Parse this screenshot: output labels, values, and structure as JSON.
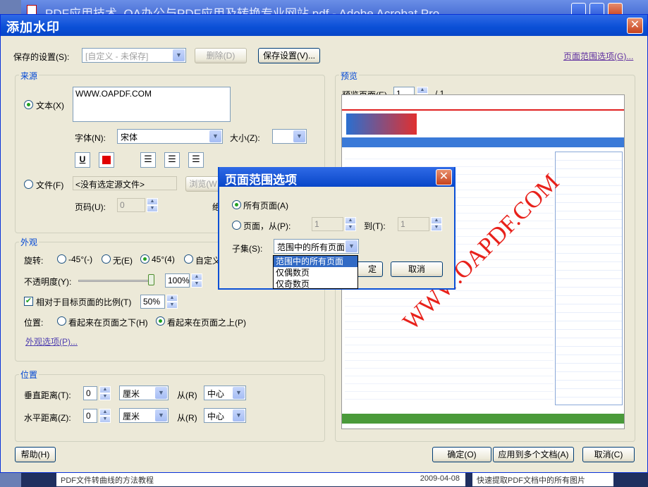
{
  "background_window": {
    "title": "PDF应用技术_OA办公与PDF应用及转换专业网站.pdf - Adobe Acrobat Pro",
    "bottom_left": "PDF文件转曲线的方法教程",
    "bottom_date": "2009-04-08",
    "bottom_right": "快速提取PDF文档中的所有图片"
  },
  "dialog": {
    "title": "添加水印",
    "close": "✕",
    "saved_settings_label": "保存的设置(S):",
    "saved_settings_value": "[自定义 - 未保存]",
    "delete_label": "删除(D)",
    "save_settings_label": "保存设置(V)...",
    "page_range_link": "页面范围选项(G)...",
    "source": {
      "title": "来源",
      "text_label": "文本(X)",
      "text_value": "WWW.OAPDF.COM",
      "font_label": "字体(N):",
      "font_value": "宋体",
      "size_label": "大小(Z):",
      "size_value": "",
      "file_label": "文件(F)",
      "file_value": "<没有选定源文件>",
      "browse_label": "浏览(W",
      "page_num_label": "页码(U):",
      "page_num_value": "0",
      "extra_label": "绝"
    },
    "appearance": {
      "title": "外观",
      "rotation_label": "旋转:",
      "rot_neg45": "-45°(-)",
      "rot_none": "无(E)",
      "rot_45": "45°(4)",
      "rot_custom": "自定义",
      "opacity_label": "不透明度(Y):",
      "opacity_value": "100%",
      "scale_label": "相对于目标页面的比例(T)",
      "scale_value": "50%",
      "position_label": "位置:",
      "pos_below": "看起来在页面之下(H)",
      "pos_above": "看起来在页面之上(P)",
      "appearance_options": "外观选项(P)..."
    },
    "position": {
      "title": "位置",
      "vertical_label": "垂直距离(T):",
      "vertical_value": "0",
      "vertical_unit": "厘米",
      "from1_label": "从(R)",
      "from1_value": "中心",
      "horizontal_label": "水平距离(Z):",
      "horizontal_value": "0",
      "horizontal_unit": "厘米",
      "from2_label": "从(R)",
      "from2_value": "中心"
    },
    "preview": {
      "title": "预览",
      "page_label": "预览页面(E)",
      "page_value": "1",
      "page_total": "/ 1",
      "watermark_text": "WWW.OAPDF.COM"
    },
    "help_label": "帮助(H)",
    "ok_label": "确定(O)",
    "apply_multi_label": "应用到多个文档(A)",
    "cancel_label": "取消(C)"
  },
  "popup": {
    "title": "页面范围选项",
    "close": "✕",
    "all_pages": "所有页面(A)",
    "pages_from": "页面，从(P):",
    "from_value": "1",
    "to_label": "到(T):",
    "to_value": "1",
    "subset_label": "子集(S):",
    "subset_value": "范围中的所有页面",
    "ok_label": "定",
    "cancel_label": "取消",
    "options": [
      "范围中的所有页面",
      "仅偶数页",
      "仅奇数页"
    ]
  },
  "colors": {
    "accent": "#0a4fd6",
    "watermark": "#e8211b"
  }
}
